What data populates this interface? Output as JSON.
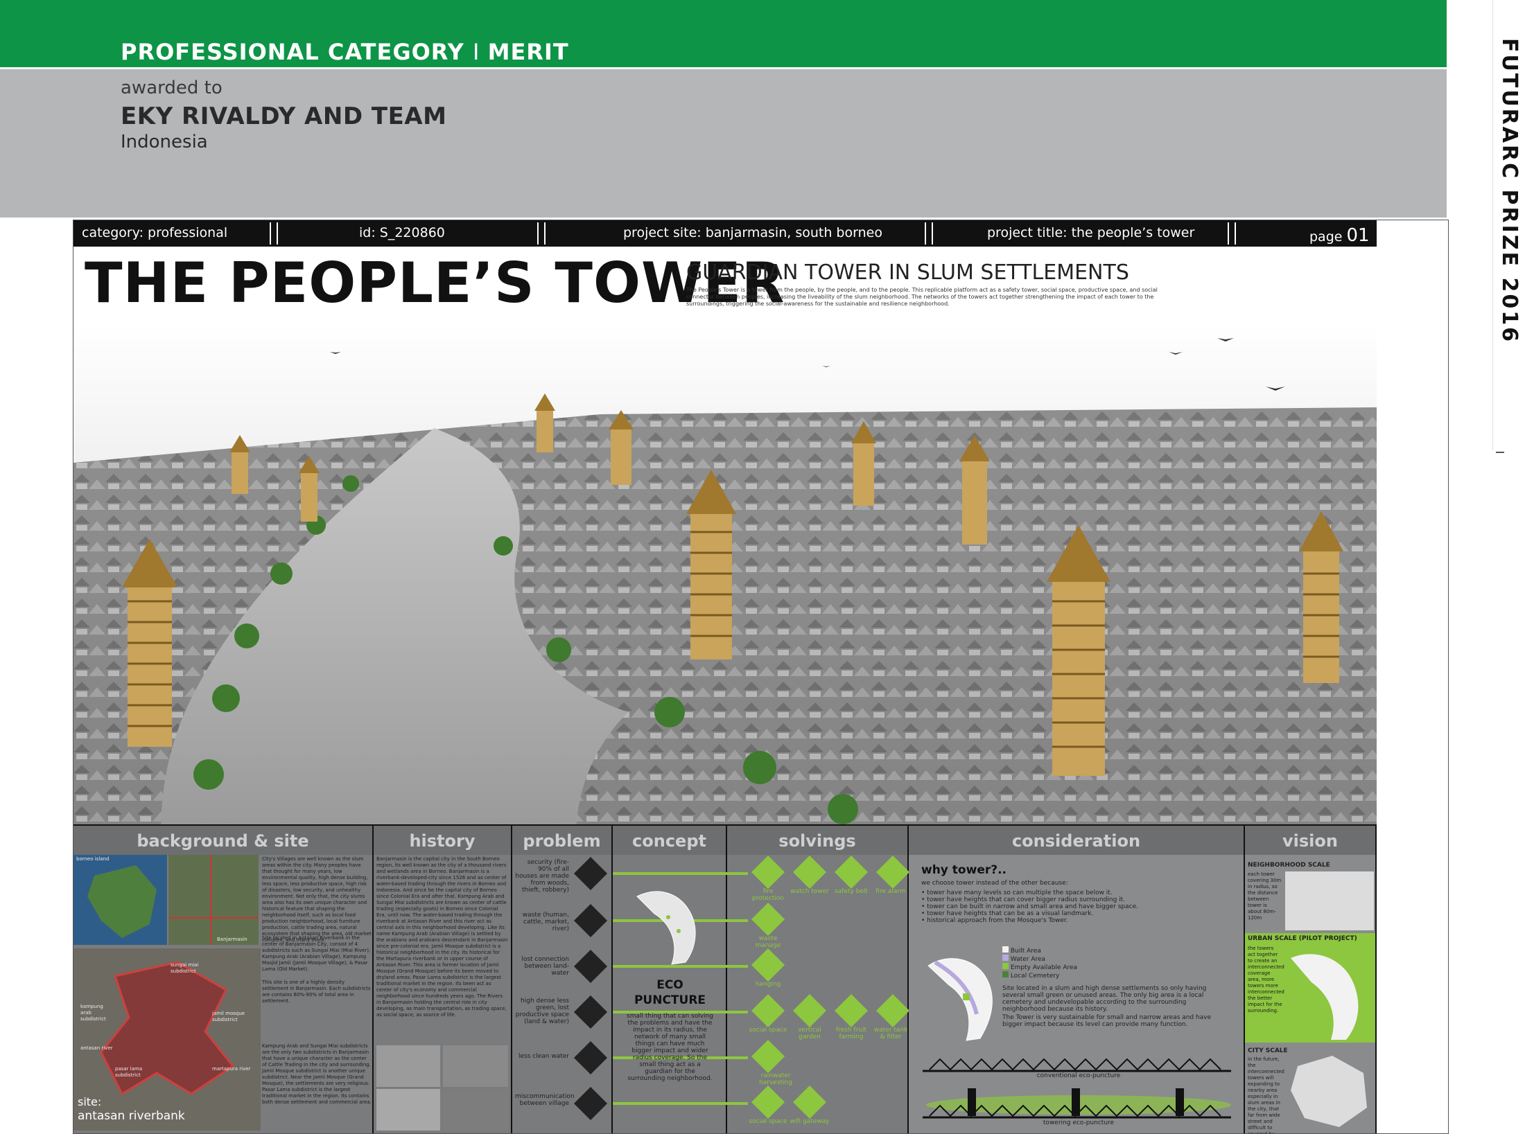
{
  "header": {
    "category_line_left": "PROFESSIONAL CATEGORY",
    "category_line_right": "MERIT",
    "awarded_to": "awarded to",
    "winner": "EKY RIVALDY AND TEAM",
    "country": "Indonesia",
    "side_label": "FUTURARC PRIZE 2016"
  },
  "infobar": {
    "category": "category: professional",
    "id": "id: S_220860",
    "site": "project site: banjarmasin, south borneo",
    "title": "project title: the people’s tower",
    "page_label": "page",
    "page_number": "01"
  },
  "title": {
    "main": "THE PEOPLE’S TOWER",
    "subtitle": "GUARDIAN TOWER IN SLUM SETTLEMENTS",
    "intro": "The People's Tower is a tower from the people, by the people, and to the people. This replicable platform act as a safety tower, social space, productive space, and social connector between peoples, increasing the liveability of the slum neighborhood. The networks of the towers act together strengthening the impact of each tower to the surroundings, triggering the social-awareness for the sustainable and resilience neighborhood."
  },
  "panels": {
    "background": {
      "header": "background & site",
      "map_label": "borneo island",
      "city_label": "Banjarmasin",
      "site_label_1": "site:",
      "site_label_2": "antasan riverbank",
      "subdistricts": [
        "sungai miai subdistrict",
        "kampung arab subdistrict",
        "jamil mosque subdistrict",
        "antasan river",
        "pasar lama subdistrict",
        "martapura river"
      ],
      "text_1": "City's Villages are well known as the slum areas within the city. Many peoples have that thought for many years, low environmental quality, high dense building, less space, less productive space, high risk of disasters, low security, and unhealthy environment. Not only that, the city slums area also has its own unique character and historical feature that shaping the neighborhood itself, such as local food production neighborhood, local furniture production, cattle trading area, natural ecosystem that shaping the area, old market complex, and many more.",
      "text_2": "Site located in Antasan Riverbank in the center of Banjarmasin City, consist of 4 subdistricts such as Sungai Miai (Miai River), Kampung Arab (Arabian Village), Kampung Masjid Jamii (Jamii Mosque Village), & Pasar Lama (Old Market).",
      "text_3": "This site is one of a highly density settlement in Banjarmasin. Each subdistricts are contains 80%-90% of total area in settlement.",
      "text_4": "Kampung Arab and Sungai Miai subdistricts are the only two subdistricts in Banjarmasin that have a unique character as the center of Cattle Trading in the city and surrounding. Jamii Mosque subdistrict is another unique subdistrict. Near the Jamii Mosque (Grand Mosque), the settlements are very religious. Pasar Lama subdistrict is the largest traditional market in the region. Its contains both dense settlement and commercial area."
    },
    "history": {
      "header": "history",
      "text": "Banjarmasin is the capital city in the South Borneo region, its well known as the city of a thousand rivers and wetlands area in Borneo. Banjarmasin is a riverbank-developed-city since 1526 and as center of water-based trading through the rivers in Borneo and Indonesia. And since be the capital city of Borneo since Colonial Era and after that. Kampung Arab and Sungai Miai subdistricts are known as center of cattle trading (especially goats) in Borneo since Colonial Era, until now. The water-based trading through the riverbank at Antasan River and this river act as central axis in this neighborhood developing. Like its name Kampung Arab (Arabian Village) is settled by the arabians and arabians descendant in Banjarmasin since pre-colonial era. Jamii Mosque subdistrict is a historical neighborhood in the city. Its historical for the Martapura riverbank or in upper course of Antasan River. This area is former location of Jamii Mosque (Grand Mosque) before its been moved to dryland areas. Pasar Lama subdistrict is the largest traditional market in the region. Its been act as center of city's economy and commercial neighborhood since hundreds years ago. The Rivers in Banjarmasin holding the central role in city developing, as main transportation, as trading space, as social space, as source of life."
    },
    "problem": {
      "header": "problem",
      "items": [
        "security (fire-90% of all houses are made from woods, thieft, robbery)",
        "waste (human, cattle, market, river)",
        "lost connection between land-water",
        "high dense less green, lost productive space (land & water)",
        "less clean water",
        "miscommunication between village"
      ]
    },
    "concept": {
      "header": "concept",
      "eco_1": "ECO",
      "eco_2": "PUNCTURE",
      "text": "small thing that can solving the problems and have the impact in its radius, the network of many small things can have much bigger impact and wider radius coverage. So the small thing act as a guardian for the surrounding neighborhood."
    },
    "solvings": {
      "header": "solvings",
      "row1": [
        "fire protection",
        "watch tower",
        "safety belt",
        "fire alarm"
      ],
      "row2": [
        "waste manage"
      ],
      "row3": [
        "hanging"
      ],
      "row4": [
        "social space",
        "vertical garden",
        "fresh fruit farming",
        "water tank & filter"
      ],
      "row5": [
        "rainwater harvesting"
      ],
      "row6": [
        "social space",
        "wifi gateway"
      ]
    },
    "consideration": {
      "header": "consideration",
      "why": "why tower?..",
      "lead": "we choose tower instead of the other because:",
      "bullets": [
        "tower have many levels so can multiple the space below it.",
        "tower have heights that can cover bigger radius surrounding it.",
        "tower can be built in narrow and small area and have bigger space.",
        "tower have heights that can be as a visual landmark.",
        "historical approach from the Mosque's Tower."
      ],
      "legend": [
        "Built Area",
        "Water Area",
        "Empty Available Area",
        "Local Cemetery"
      ],
      "site_note": "Site located in a slum and high dense settlements so only having several small green or unused areas. The only big area is a local cemetery and undevelopable according to the surrounding neighborhood because its history.",
      "tower_note": "The Tower is very sustainable for small and narrow areas and have bigger impact because its level can provide many function.",
      "conv": "conventional eco-puncture",
      "tow": "towering eco-puncture"
    },
    "vision": {
      "header": "vision",
      "scale1": "NEIGHBORHOOD SCALE",
      "scale1_text": "each tower covering 30m in radius, so the distance between tower is about 80m-120m",
      "scale2": "URBAN SCALE (PILOT PROJECT)",
      "scale2_text": "the towers act together to create an interconnected coverage area, more towers more interconnected the better impact for the surrounding.",
      "scale3": "CITY SCALE",
      "scale3_text": "in the future, the interconnected towers will expanding to nearby area especially in slum areas in the city, that far from wide street and difficult to covered by the fire fighter"
    }
  },
  "colors": {
    "brand_green": "#0d9447",
    "accent_green": "#8dc63f",
    "panel_gray": "#7a7b7d",
    "header_gray": "#6d6e70"
  }
}
